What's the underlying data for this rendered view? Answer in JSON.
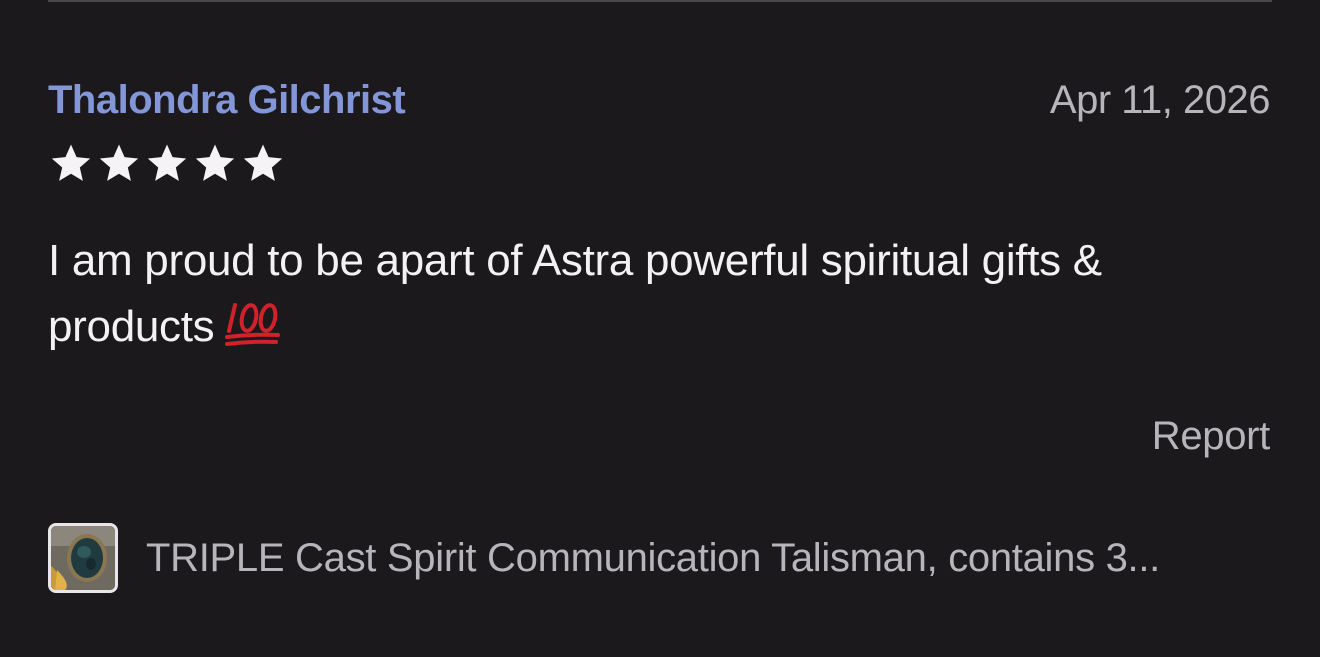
{
  "review": {
    "reviewer_name": "Thalondra Gilchrist",
    "date": "Apr 11, 2026",
    "rating": 5,
    "rating_max": 5,
    "body_text": "I am proud to be apart of Astra powerful spiritual gifts & products",
    "emoji": "hundred-points-emoji",
    "report_label": "Report"
  },
  "product": {
    "title": "TRIPLE Cast Spirit Communication Talisman, contains 3..."
  },
  "colors": {
    "background": "#1c191d",
    "reviewer_name": "#8397d8",
    "muted_text": "#b8b5ba",
    "body_text": "#f3f1f3",
    "star": "#f5f3f5",
    "emoji": "#d0222a"
  },
  "icons": {
    "star": "star-icon",
    "emoji": "hundred-points-icon",
    "thumbnail": "product-thumbnail"
  }
}
